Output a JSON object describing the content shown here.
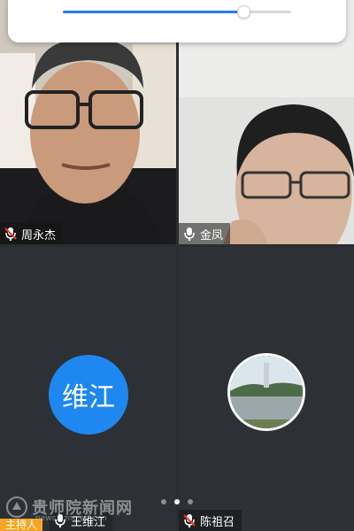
{
  "volume": {
    "level": 0.79
  },
  "participants": [
    {
      "name": "周永杰",
      "mic": "muted"
    },
    {
      "name": "金凤",
      "mic": "on"
    },
    {
      "name": "王维江",
      "avatar_text": "维江",
      "mic": "on",
      "role": "主持人"
    },
    {
      "name": "陈祖召",
      "mic": "muted"
    }
  ],
  "pager": {
    "pages": 3,
    "current": 2
  },
  "watermark": {
    "title": "贵师院新闻网",
    "url": "news.gznc.edu.cn"
  },
  "colors": {
    "accent": "#2a7be4",
    "avatar": "#1e88f0",
    "host_badge": "#f5a623",
    "muted_mic": "#e53935"
  }
}
